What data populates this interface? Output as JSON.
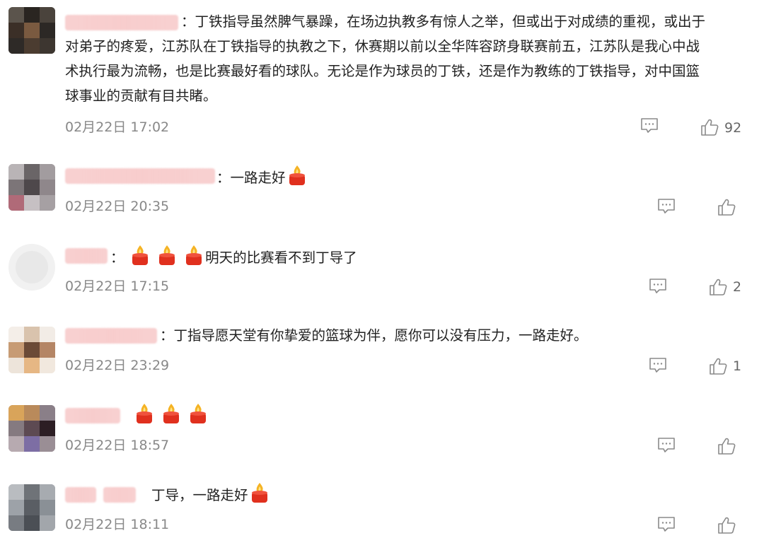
{
  "comments": [
    {
      "prefix": "：",
      "text_lines": [
        "丁铁指导虽然脾气暴躁，在场边执教多有惊人之举，但或出于对成绩的重视，或出于",
        "对弟子的疼爱，江苏队在丁铁指导的执教之下，休赛期以前以全华阵容跻身联赛前五，江苏队是我心中战",
        "术执行最为流畅，也是比赛最好看的球队。无论是作为球员的丁铁，还是作为教练的丁铁指导，对中国篮",
        "球事业的贡献有目共睹。"
      ],
      "time": "02月22日 17:02",
      "likes": "92"
    },
    {
      "prefix": "：",
      "text": "一路走好",
      "time": "02月22日 20:35",
      "likes": ""
    },
    {
      "prefix": "：",
      "text": "明天的比赛看不到丁导了",
      "time": "02月22日 17:15",
      "likes": "2"
    },
    {
      "prefix": "：",
      "text": "丁指导愿天堂有你挚爱的篮球为伴，愿你可以没有压力，一路走好。",
      "time": "02月22日 23:29",
      "likes": "1"
    },
    {
      "prefix": "",
      "text": "",
      "time": "02月22日 18:57",
      "likes": ""
    },
    {
      "prefix": "",
      "text": "丁导，一路走好",
      "time": "02月22日 18:11",
      "likes": ""
    }
  ],
  "icons": {
    "reply": "comment-icon",
    "like": "thumbs-up-icon",
    "emoji": "candle-emoji"
  },
  "colors": {
    "text": "#222222",
    "time": "#888888",
    "icon": "#999999"
  }
}
